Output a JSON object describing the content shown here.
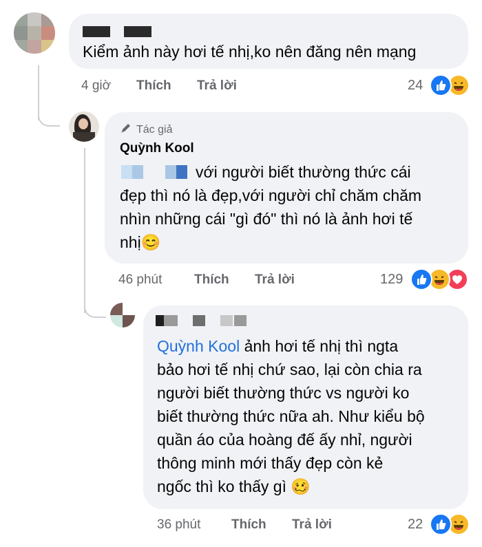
{
  "comments": [
    {
      "text": "Kiểm ảnh này hơi tế nhị,ko nên đăng nên mạng",
      "time": "4 giờ",
      "like_label": "Thích",
      "reply_label": "Trả lời",
      "reaction_count": "24",
      "reactions": [
        "like-icon",
        "haha-icon"
      ]
    },
    {
      "author_badge": "Tác giả",
      "author_name": "Quỳnh Kool",
      "text_line1": "với người biết thường thức cái",
      "text_line2": "đẹp thì nó là đẹp,với người chỉ chăm chăm",
      "text_line3": "nhìn những cái \"gì đó\" thì nó là ảnh hơi tế",
      "text_line4": "nhị",
      "emoji": "😊",
      "time": "46 phút",
      "like_label": "Thích",
      "reply_label": "Trả lời",
      "reaction_count": "129",
      "reactions": [
        "like-icon",
        "haha-icon",
        "love-icon"
      ]
    },
    {
      "mention": "Quỳnh Kool",
      "text_line1": " ảnh hơi tế nhị thì ngta",
      "text_line2": "bảo hơi tế nhị chứ sao, lại còn chia ra",
      "text_line3": "người biết thường thức vs người ko",
      "text_line4": "biết thường thức nữa ah. Như kiểu bộ",
      "text_line5": "quần áo của hoàng đế ấy nhỉ, người",
      "text_line6": "thông minh mới thấy đẹp còn kẻ",
      "text_line7": "ngốc thì ko thấy gì",
      "emoji": "🥴",
      "time": "36 phút",
      "like_label": "Thích",
      "reply_label": "Trả lời",
      "reaction_count": "22",
      "reactions": [
        "like-icon",
        "haha-icon"
      ]
    }
  ],
  "colors": {
    "bubble": "#f0f2f5",
    "meta_text": "#65676b",
    "mention": "#216fdb",
    "like_blue": "#1877f2",
    "haha_yellow": "#f7b928",
    "love_red": "#f33e58"
  }
}
